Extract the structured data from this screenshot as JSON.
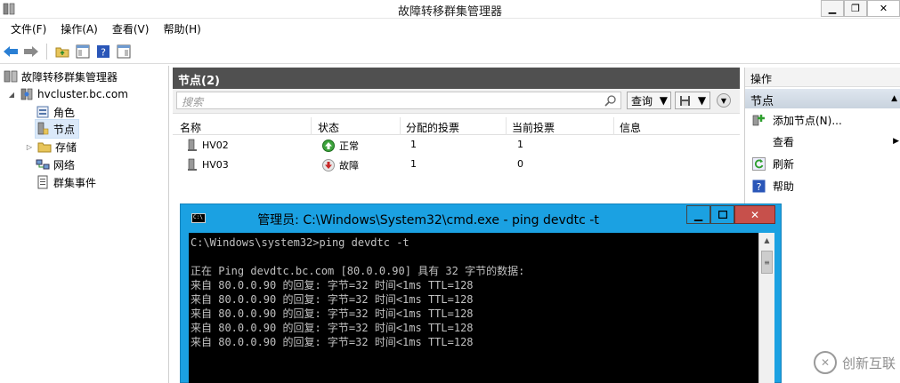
{
  "window": {
    "title": "故障转移群集管理器",
    "minimize_glyph": "▁",
    "maximize_glyph": "❐",
    "close_glyph": "✕"
  },
  "menu": [
    "文件(F)",
    "操作(A)",
    "查看(V)",
    "帮助(H)"
  ],
  "toolbar": {
    "icons": [
      "back-arrow-icon",
      "forward-arrow-icon",
      "folder-up-icon",
      "show-hide-console-tree-icon",
      "help-icon",
      "show-hide-action-pane-icon"
    ]
  },
  "tree": {
    "root": "故障转移群集管理器",
    "cluster": "hvcluster.bc.com",
    "children": [
      "角色",
      "节点",
      "存储",
      "网络",
      "群集事件"
    ],
    "selected": "节点"
  },
  "center": {
    "header": "节点(2)",
    "search_placeholder": "搜索",
    "query_label": "查询",
    "columns": [
      "名称",
      "状态",
      "分配的投票",
      "当前投票",
      "信息"
    ],
    "rows": [
      {
        "name": "HV02",
        "status": "正常",
        "status_icon": "up-arrow-green-icon",
        "assigned_votes": "1",
        "current_votes": "1",
        "info": ""
      },
      {
        "name": "HV03",
        "status": "故障",
        "status_icon": "down-arrow-red-icon",
        "assigned_votes": "1",
        "current_votes": "0",
        "info": ""
      }
    ]
  },
  "actions": {
    "header": "操作",
    "section": "节点",
    "items": [
      {
        "label": "添加节点(N)...",
        "icon": "add-node-icon"
      },
      {
        "label": "查看",
        "icon": "",
        "submenu": true
      },
      {
        "label": "刷新",
        "icon": "refresh-icon"
      },
      {
        "label": "帮助",
        "icon": "help-icon"
      }
    ]
  },
  "cmd": {
    "title": "管理员: C:\\Windows\\System32\\cmd.exe - ping  devdtc -t",
    "icon_text": "C:\\",
    "lines": [
      "C:\\Windows\\system32>ping devdtc -t",
      "",
      "正在 Ping devdtc.bc.com [80.0.0.90] 具有 32 字节的数据:",
      "来自 80.0.0.90 的回复: 字节=32 时间<1ms TTL=128",
      "来自 80.0.0.90 的回复: 字节=32 时间<1ms TTL=128",
      "来自 80.0.0.90 的回复: 字节=32 时间<1ms TTL=128",
      "来自 80.0.0.90 的回复: 字节=32 时间<1ms TTL=128",
      "来自 80.0.0.90 的回复: 字节=32 时间<1ms TTL=128"
    ]
  },
  "watermark": {
    "text": "创新互联",
    "logo_glyph": "✕"
  }
}
